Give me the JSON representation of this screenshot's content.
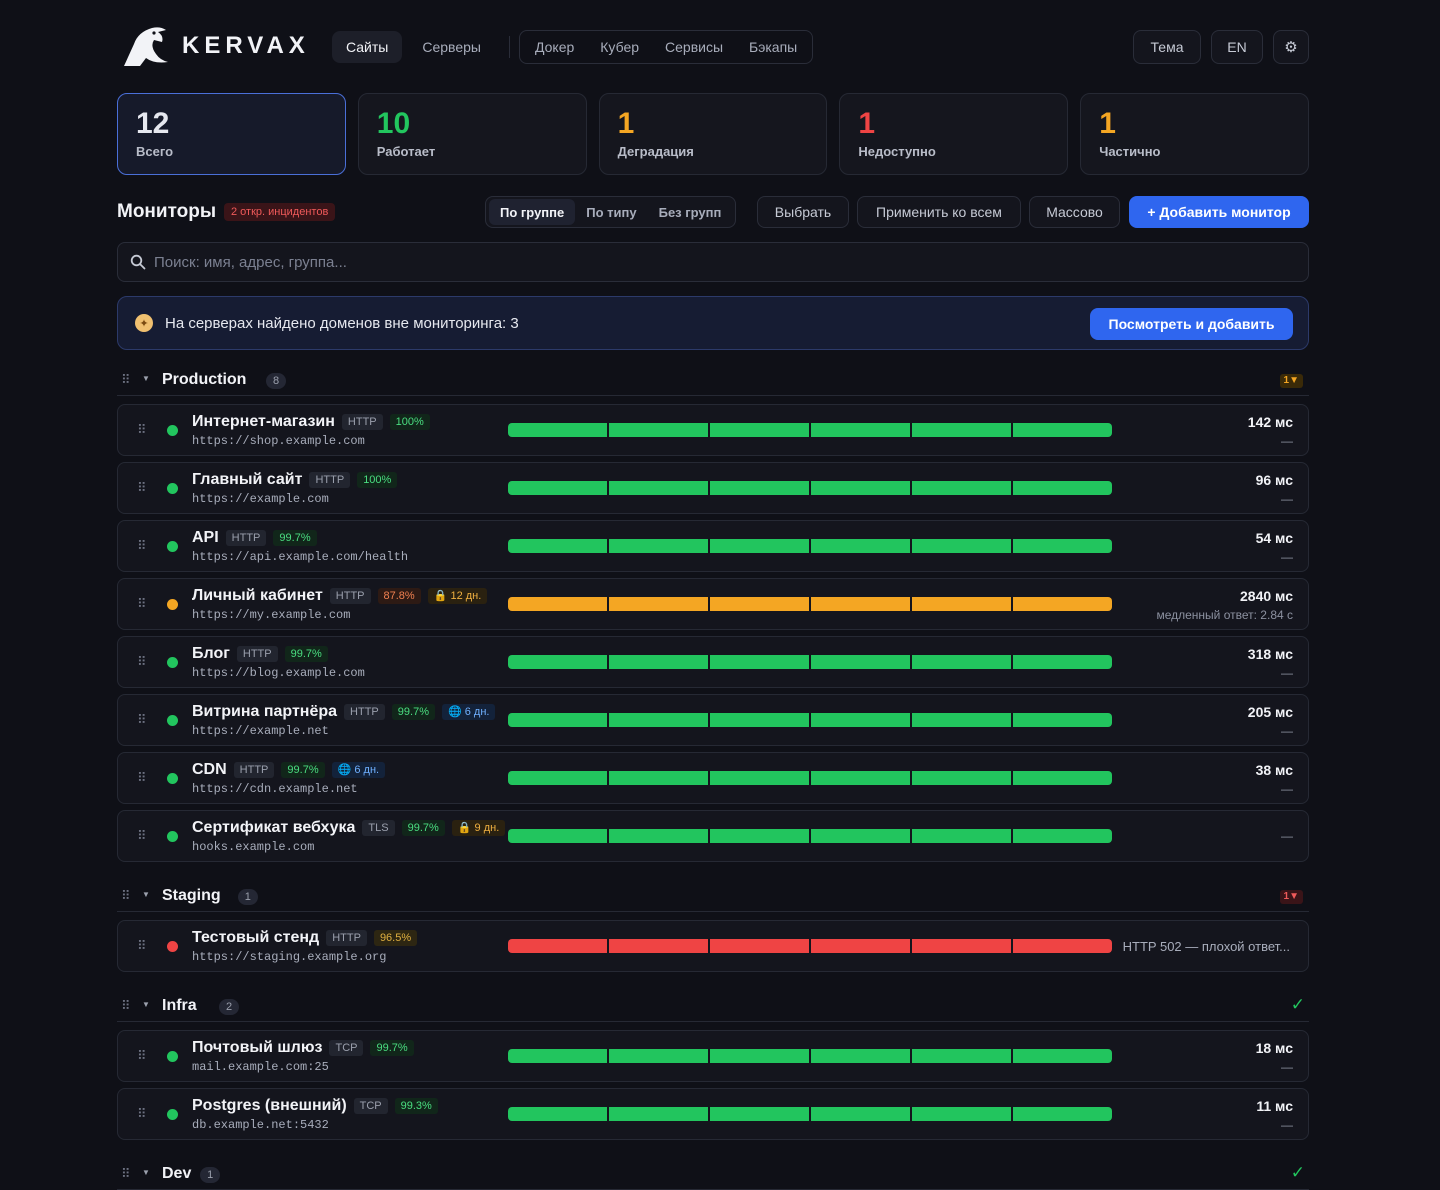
{
  "brand": {
    "name": "KERVAX"
  },
  "nav": {
    "main": [
      "Сайты",
      "Серверы"
    ],
    "group": [
      "Докер",
      "Кубер",
      "Сервисы",
      "Бэкапы"
    ],
    "theme": "Тема",
    "lang": "EN",
    "settings_icon": "gear-icon"
  },
  "stats": [
    {
      "value": "12",
      "label": "Всего",
      "color": "#e6e8ef"
    },
    {
      "value": "10",
      "label": "Работает",
      "color": "#22c55e"
    },
    {
      "value": "1",
      "label": "Деградация",
      "color": "#f4a623"
    },
    {
      "value": "1",
      "label": "Недоступно",
      "color": "#ef4444"
    },
    {
      "value": "1",
      "label": "Частично",
      "color": "#f4a623"
    }
  ],
  "toolbar": {
    "title": "Мониторы",
    "incidents": "2 откр. инцидентов",
    "grouping": [
      "По группе",
      "По типу",
      "Без групп"
    ],
    "select": "Выбрать",
    "apply_all": "Применить ко всем",
    "bulk": "Массово",
    "add": "+ Добавить монитор"
  },
  "search": {
    "placeholder": "Поиск: имя, адрес, группа..."
  },
  "banner": {
    "text": "На серверах найдено доменов вне мониторинга: 3",
    "button": "Посмотреть и добавить"
  },
  "colors": {
    "up": "#22c55e",
    "degraded": "#f4a623",
    "down": "#ef4444",
    "accent": "#2f66ef"
  },
  "groups": [
    {
      "name": "Production",
      "count": "8",
      "status": "1▼",
      "monitors": [
        {
          "name": "Интернет-магазин",
          "type": "HTTP",
          "uptime": "100%",
          "url": "https://shop.example.com",
          "ms": "142 мс",
          "sub": "—",
          "state": "up"
        },
        {
          "name": "Главный сайт",
          "type": "HTTP",
          "uptime": "100%",
          "url": "https://example.com",
          "ms": "96 мс",
          "sub": "—",
          "state": "up"
        },
        {
          "name": "API",
          "type": "HTTP",
          "uptime": "99.7%",
          "url": "https://api.example.com/health",
          "ms": "54 мс",
          "sub": "—",
          "state": "up"
        },
        {
          "name": "Личный кабинет",
          "type": "HTTP",
          "uptime": "87.8%",
          "tag": "🔒 12 дн.",
          "url": "https://my.example.com",
          "ms": "2840 мс",
          "sub": "медленный ответ: 2.84 с",
          "state": "degraded"
        },
        {
          "name": "Блог",
          "type": "HTTP",
          "uptime": "99.7%",
          "url": "https://blog.example.com",
          "ms": "318 мс",
          "sub": "—",
          "state": "up"
        },
        {
          "name": "Витрина партнёра",
          "type": "HTTP",
          "uptime": "99.7%",
          "tag": "🌐 6 дн.",
          "url": "https://example.net",
          "ms": "205 мс",
          "sub": "—",
          "state": "up"
        },
        {
          "name": "CDN",
          "type": "HTTP",
          "uptime": "99.7%",
          "tag": "🌐 6 дн.",
          "url": "https://cdn.example.net",
          "ms": "38 мс",
          "sub": "—",
          "state": "up"
        },
        {
          "name": "Сертификат вебхука",
          "type": "TLS",
          "uptime": "99.7%",
          "tag": "🔒 9 дн.",
          "url": "hooks.example.com",
          "ms": "",
          "sub": "—",
          "state": "up"
        }
      ]
    },
    {
      "name": "Staging",
      "count": "1",
      "status": "1▼",
      "monitors": [
        {
          "name": "Тестовый стенд",
          "type": "HTTP",
          "uptime": "96.5%",
          "url": "https://staging.example.org",
          "error": "HTTP 502 — плохой ответ...",
          "state": "down"
        }
      ]
    },
    {
      "name": "Infra",
      "count": "2",
      "status": "✓",
      "monitors": [
        {
          "name": "Почтовый шлюз",
          "type": "TCP",
          "uptime": "99.7%",
          "url": "mail.example.com:25",
          "ms": "18 мс",
          "sub": "—",
          "state": "up"
        },
        {
          "name": "Postgres (внешний)",
          "type": "TCP",
          "uptime": "99.3%",
          "url": "db.example.net:5432",
          "ms": "11 мс",
          "sub": "—",
          "state": "up"
        }
      ]
    },
    {
      "name": "Dev",
      "count": "1",
      "status": "✓",
      "monitors": []
    }
  ]
}
